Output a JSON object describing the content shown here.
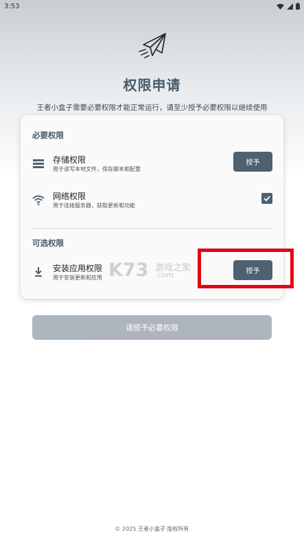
{
  "status_bar": {
    "time": "3:53"
  },
  "header": {
    "title": "权限申请",
    "subtitle": "王者小盒子需要必要权限才能正常运行，请至少授予必要权限以继续使用"
  },
  "required_section": {
    "title": "必要权限",
    "items": [
      {
        "name": "存储权限",
        "desc": "用于读写本地文件，保存脚本和配置",
        "action": "授予",
        "icon": "storage-list-icon",
        "granted": false
      },
      {
        "name": "网络权限",
        "desc": "用于连接服务器，获取更新和功能",
        "icon": "wifi-icon",
        "granted": true
      }
    ]
  },
  "optional_section": {
    "title": "可选权限",
    "items": [
      {
        "name": "安装应用权限",
        "desc": "用于安装更新和应用",
        "action": "授予",
        "icon": "download-icon",
        "granted": false
      }
    ]
  },
  "watermark": {
    "big": "K73",
    "cn": "游戏之家",
    "com": ".com"
  },
  "main_button": {
    "label": "请授予必要权限",
    "enabled": false
  },
  "footer": {
    "text": "© 2025 王者小盒子 版权所有"
  },
  "colors": {
    "accent": "#4e6170",
    "title": "#4a5a68",
    "highlight": "#e10613",
    "disabled_button": "#a9b1b9"
  }
}
